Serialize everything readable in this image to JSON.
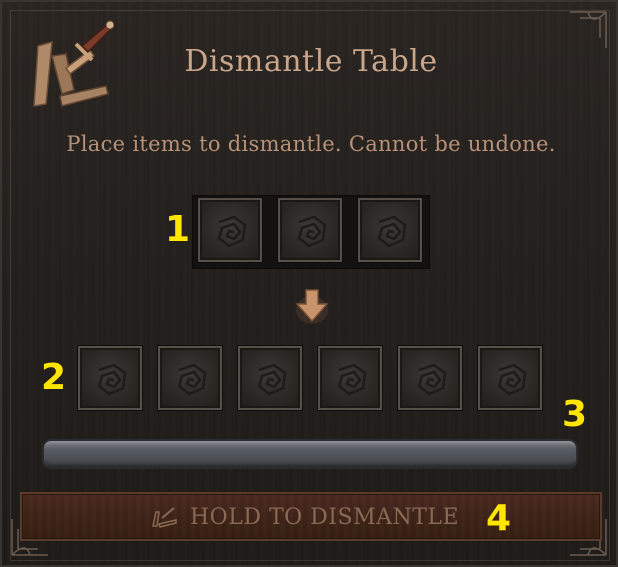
{
  "window": {
    "title": "Dismantle Table",
    "subtitle": "Place items to dismantle. Cannot be undone."
  },
  "icons": {
    "title_icon": "broken-sword-icon",
    "slot_icon": "empty-slot-spiral-icon",
    "arrow_icon": "arrow-down-icon",
    "button_icon": "dismantle-hammer-icon"
  },
  "input_slots": [
    {
      "state": "empty"
    },
    {
      "state": "empty"
    },
    {
      "state": "empty"
    }
  ],
  "output_slots": [
    {
      "state": "empty"
    },
    {
      "state": "empty"
    },
    {
      "state": "empty"
    },
    {
      "state": "empty"
    },
    {
      "state": "empty"
    },
    {
      "state": "empty"
    }
  ],
  "progress": {
    "value": 0
  },
  "button": {
    "label": "HOLD TO DISMANTLE"
  },
  "annotations": {
    "input": "1",
    "output": "2",
    "progress": "3",
    "button": "4"
  },
  "colors": {
    "title": "#c9a58a",
    "subtitle": "#b89278",
    "annotation": "#ffe600",
    "button_bg": "#3f2318",
    "button_text": "#8a6a55"
  }
}
